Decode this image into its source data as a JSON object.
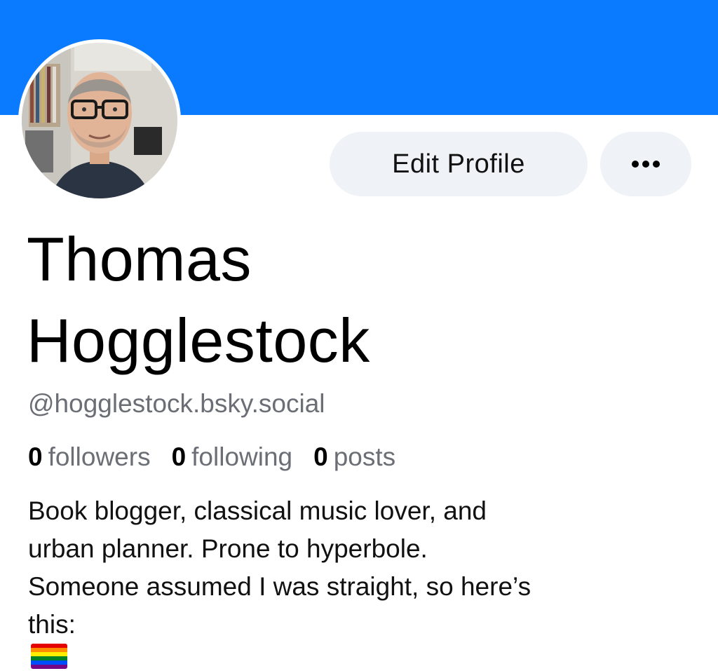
{
  "profile": {
    "display_name_line1": "Thomas",
    "display_name_line2": "Hogglestock",
    "handle": "@hogglestock.bsky.social",
    "banner_color": "#0a7aff"
  },
  "actions": {
    "edit_label": "Edit Profile",
    "more_icon": "ellipsis-icon"
  },
  "stats": {
    "followers_count": "0",
    "followers_label": "followers",
    "following_count": "0",
    "following_label": "following",
    "posts_count": "0",
    "posts_label": "posts"
  },
  "bio": {
    "line1": "Book blogger, classical music lover, and",
    "line2": "urban planner. Prone to hyperbole.",
    "line3": "Someone assumed I was straight, so here’s",
    "line4": "this:",
    "emoji": "rainbow-flag-icon"
  }
}
